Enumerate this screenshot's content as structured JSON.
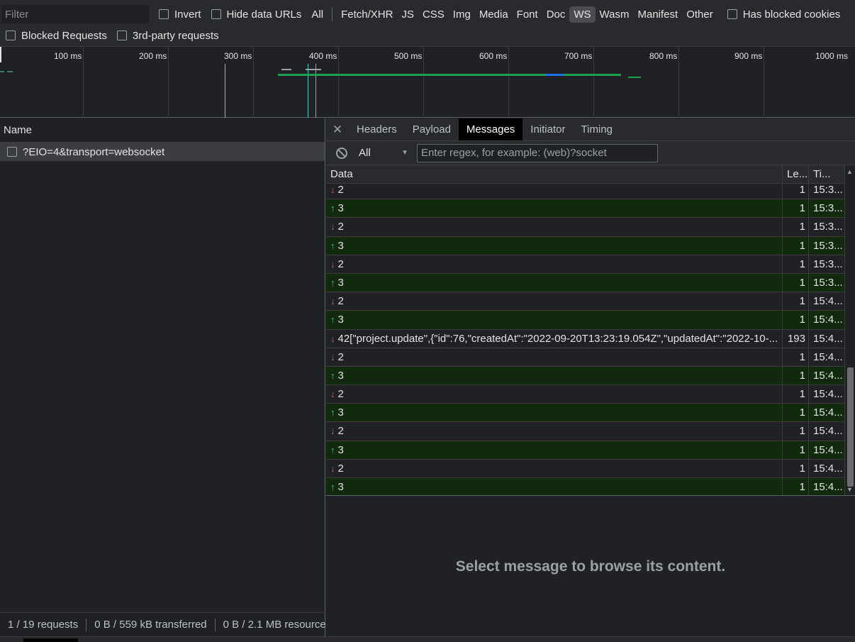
{
  "toolbar": {
    "filter_placeholder": "Filter",
    "invert_label": "Invert",
    "hide_data_urls_label": "Hide data URLs",
    "types": [
      "All",
      "Fetch/XHR",
      "JS",
      "CSS",
      "Img",
      "Media",
      "Font",
      "Doc",
      "WS",
      "Wasm",
      "Manifest",
      "Other"
    ],
    "active_type": "WS",
    "has_blocked_cookies_label": "Has blocked cookies",
    "blocked_requests_label": "Blocked Requests",
    "third_party_label": "3rd-party requests"
  },
  "timeline": {
    "ticks": [
      "100 ms",
      "200 ms",
      "300 ms",
      "400 ms",
      "500 ms",
      "600 ms",
      "700 ms",
      "800 ms",
      "900 ms",
      "1000 ms"
    ]
  },
  "requests": {
    "column_name": "Name",
    "items": [
      {
        "name": "?EIO=4&transport=websocket"
      }
    ]
  },
  "status": {
    "requests": "1 / 19 requests",
    "transferred": "0 B / 559 kB transferred",
    "resources": "0 B / 2.1 MB resource"
  },
  "detail": {
    "tabs": [
      "Headers",
      "Payload",
      "Messages",
      "Initiator",
      "Timing"
    ],
    "active_tab": "Messages",
    "filter_select": "All",
    "regex_placeholder": "Enter regex, for example: (web)?socket",
    "columns": {
      "data": "Data",
      "length": "Le...",
      "time": "Ti..."
    },
    "messages": [
      {
        "dir": "down",
        "data": "2",
        "length": "1",
        "time": "15:3..."
      },
      {
        "dir": "up",
        "data": "3",
        "length": "1",
        "time": "15:3..."
      },
      {
        "dir": "down",
        "data": "2",
        "length": "1",
        "time": "15:3..."
      },
      {
        "dir": "up",
        "data": "3",
        "length": "1",
        "time": "15:3..."
      },
      {
        "dir": "down",
        "data": "2",
        "length": "1",
        "time": "15:3..."
      },
      {
        "dir": "up",
        "data": "3",
        "length": "1",
        "time": "15:3..."
      },
      {
        "dir": "down",
        "data": "2",
        "length": "1",
        "time": "15:4..."
      },
      {
        "dir": "up",
        "data": "3",
        "length": "1",
        "time": "15:4..."
      },
      {
        "dir": "down",
        "data": "42[\"project.update\",{\"id\":76,\"createdAt\":\"2022-09-20T13:23:19.054Z\",\"updatedAt\":\"2022-10-...",
        "length": "193",
        "time": "15:4..."
      },
      {
        "dir": "down",
        "data": "2",
        "length": "1",
        "time": "15:4..."
      },
      {
        "dir": "up",
        "data": "3",
        "length": "1",
        "time": "15:4..."
      },
      {
        "dir": "down",
        "data": "2",
        "length": "1",
        "time": "15:4..."
      },
      {
        "dir": "up",
        "data": "3",
        "length": "1",
        "time": "15:4..."
      },
      {
        "dir": "down",
        "data": "2",
        "length": "1",
        "time": "15:4..."
      },
      {
        "dir": "up",
        "data": "3",
        "length": "1",
        "time": "15:4..."
      },
      {
        "dir": "down",
        "data": "2",
        "length": "1",
        "time": "15:4..."
      },
      {
        "dir": "up",
        "data": "3",
        "length": "1",
        "time": "15:4..."
      }
    ],
    "empty_message": "Select message to browse its content."
  },
  "colors": {
    "sent_row_bg": "#112a0e",
    "up_arrow": "#36c6a0",
    "down_arrow": "#ef5350",
    "active_tab_bg": "#000000"
  }
}
